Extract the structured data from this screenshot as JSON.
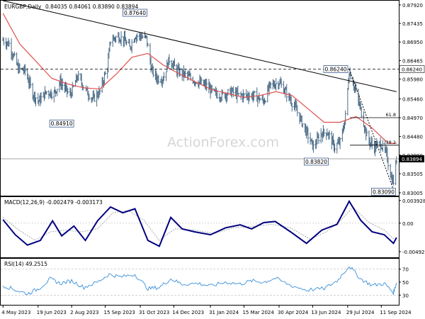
{
  "chart_data": [
    {
      "type": "bar",
      "subtype": "ohlc-price",
      "symbol_label": "EURGBP,Daily",
      "ohlc_label": "0.84035 0.84061 0.83890 0.83894",
      "last_price_label": "0.83894",
      "ylim": [
        0.8293,
        0.8803
      ],
      "y_ticks": [
        "0.87920",
        "0.87435",
        "0.86950",
        "0.86465",
        "0.85980",
        "0.85460",
        "0.84970",
        "0.84480",
        "0.83990",
        "0.83505",
        "0.83005"
      ],
      "y_tick_values": [
        0.8792,
        0.87435,
        0.8695,
        0.86465,
        0.8598,
        0.8546,
        0.8497,
        0.8448,
        0.8399,
        0.83505,
        0.83005
      ],
      "x_ticks": [
        "4 May 2023",
        "19 Jun 2023",
        "2 Aug 2023",
        "15 Sep 2023",
        "31 Oct 2023",
        "14 Dec 2023",
        "31 Jan 2024",
        "15 Mar 2024",
        "30 Apr 2024",
        "13 Jun 2024",
        "29 Jul 2024",
        "11 Sep 2024"
      ],
      "close_series": [
        [
          "2023-05-04",
          0.87
        ],
        [
          "2023-05-12",
          0.869
        ],
        [
          "2023-05-24",
          0.8625
        ],
        [
          "2023-06-02",
          0.862
        ],
        [
          "2023-06-12",
          0.856
        ],
        [
          "2023-06-20",
          0.854
        ],
        [
          "2023-06-30",
          0.8565
        ],
        [
          "2023-07-10",
          0.856
        ],
        [
          "2023-07-18",
          0.8591
        ],
        [
          "2023-07-31",
          0.8555
        ],
        [
          "2023-08-10",
          0.8605
        ],
        [
          "2023-08-22",
          0.8565
        ],
        [
          "2023-08-30",
          0.8545
        ],
        [
          "2023-09-08",
          0.8565
        ],
        [
          "2023-09-18",
          0.863
        ],
        [
          "2023-09-22",
          0.87
        ],
        [
          "2023-10-02",
          0.871
        ],
        [
          "2023-10-10",
          0.87
        ],
        [
          "2023-10-17",
          0.868
        ],
        [
          "2023-10-24",
          0.8712
        ],
        [
          "2023-10-31",
          0.871
        ],
        [
          "2023-11-08",
          0.8705
        ],
        [
          "2023-11-15",
          0.862
        ],
        [
          "2023-11-22",
          0.86
        ],
        [
          "2023-11-30",
          0.86
        ],
        [
          "2023-12-08",
          0.865
        ],
        [
          "2023-12-18",
          0.862
        ],
        [
          "2023-12-28",
          0.861
        ],
        [
          "2024-01-05",
          0.86
        ],
        [
          "2024-01-15",
          0.859
        ],
        [
          "2024-01-26",
          0.858
        ],
        [
          "2024-02-05",
          0.856
        ],
        [
          "2024-02-15",
          0.8555
        ],
        [
          "2024-02-28",
          0.8565
        ],
        [
          "2024-03-08",
          0.8555
        ],
        [
          "2024-03-20",
          0.8555
        ],
        [
          "2024-03-28",
          0.8555
        ],
        [
          "2024-04-10",
          0.854
        ],
        [
          "2024-04-18",
          0.858
        ],
        [
          "2024-04-30",
          0.859
        ],
        [
          "2024-05-10",
          0.856
        ],
        [
          "2024-05-22",
          0.852
        ],
        [
          "2024-05-30",
          0.8485
        ],
        [
          "2024-06-08",
          0.8445
        ],
        [
          "2024-06-14",
          0.842
        ],
        [
          "2024-06-24",
          0.8455
        ],
        [
          "2024-07-02",
          0.846
        ],
        [
          "2024-07-12",
          0.842
        ],
        [
          "2024-07-20",
          0.8435
        ],
        [
          "2024-07-26",
          0.85
        ],
        [
          "2024-07-31",
          0.862
        ],
        [
          "2024-08-08",
          0.857
        ],
        [
          "2024-08-16",
          0.851
        ],
        [
          "2024-08-24",
          0.844
        ],
        [
          "2024-09-02",
          0.842
        ],
        [
          "2024-09-10",
          0.843
        ],
        [
          "2024-09-18",
          0.84
        ],
        [
          "2024-09-24",
          0.834
        ],
        [
          "2024-09-27",
          0.833
        ],
        [
          "2024-10-01",
          0.8389
        ]
      ],
      "ma_series": [
        [
          "2023-05-04",
          0.877
        ],
        [
          "2023-05-26",
          0.869
        ],
        [
          "2023-06-16",
          0.8645
        ],
        [
          "2023-07-07",
          0.86
        ],
        [
          "2023-07-28",
          0.8585
        ],
        [
          "2023-08-18",
          0.8575
        ],
        [
          "2023-09-08",
          0.8572
        ],
        [
          "2023-09-29",
          0.861
        ],
        [
          "2023-10-20",
          0.8655
        ],
        [
          "2023-11-10",
          0.8665
        ],
        [
          "2023-11-30",
          0.8635
        ],
        [
          "2023-12-21",
          0.8612
        ],
        [
          "2024-01-12",
          0.859
        ],
        [
          "2024-02-02",
          0.857
        ],
        [
          "2024-02-23",
          0.856
        ],
        [
          "2024-03-15",
          0.855
        ],
        [
          "2024-04-05",
          0.8555
        ],
        [
          "2024-04-26",
          0.8565
        ],
        [
          "2024-05-17",
          0.8555
        ],
        [
          "2024-06-07",
          0.852
        ],
        [
          "2024-06-28",
          0.8485
        ],
        [
          "2024-07-19",
          0.8485
        ],
        [
          "2024-08-09",
          0.85
        ],
        [
          "2024-08-30",
          0.847
        ],
        [
          "2024-09-20",
          0.843
        ],
        [
          "2024-10-01",
          0.843
        ]
      ],
      "annotations": [
        {
          "label": "0.87640",
          "date": "2023-10-24",
          "value": 0.8764
        },
        {
          "label": "0.84910",
          "date": "2023-07-20",
          "value": 0.8491
        },
        {
          "label": "0.86240",
          "date": "2024-07-31",
          "value": 0.8624
        },
        {
          "label": "0.83820",
          "date": "2024-06-28",
          "value": 0.8382
        },
        {
          "label": "0.83090",
          "date": "2024-09-27",
          "value": 0.8309
        },
        {
          "label": "61.8",
          "date": "2024-09-10",
          "value": 0.8497
        },
        {
          "label": "38.2",
          "date": "2024-09-23",
          "value": 0.8425
        }
      ],
      "trendline": [
        [
          "2023-05-04",
          0.8803
        ],
        [
          "2024-10-01",
          0.8565
        ]
      ],
      "channel_line": [
        [
          "2024-07-31",
          0.8624
        ],
        [
          "2024-09-27",
          0.8309
        ]
      ],
      "horizontal_levels": [
        0.8624,
        0.83894
      ],
      "fib_levels": [
        0.8497,
        0.8425
      ],
      "watermark": "ActionForex.com",
      "colors": {
        "bars": "#4a6b87",
        "ma": "#e05050",
        "trend": "#000000",
        "last_price": "#000000"
      }
    },
    {
      "type": "line",
      "title": "MACD(12,26,9) -0.002479 -0.003173",
      "y_ticks": [
        "0.003928",
        "0.00",
        "-0.004929"
      ],
      "y_tick_values": [
        0.003928,
        0.0,
        -0.004929
      ],
      "ylim": [
        -0.0058,
        0.0044
      ],
      "series": [
        {
          "name": "MACD",
          "color": "#000080",
          "points": [
            [
              "2023-05-04",
              0.0006
            ],
            [
              "2023-05-20",
              -0.002
            ],
            [
              "2023-06-05",
              -0.0038
            ],
            [
              "2023-06-22",
              -0.003
            ],
            [
              "2023-07-08",
              0.0004
            ],
            [
              "2023-07-20",
              -0.0022
            ],
            [
              "2023-08-05",
              -0.0005
            ],
            [
              "2023-08-20",
              -0.003
            ],
            [
              "2023-09-05",
              0.0004
            ],
            [
              "2023-09-22",
              0.0028
            ],
            [
              "2023-10-08",
              0.0018
            ],
            [
              "2023-10-24",
              0.0025
            ],
            [
              "2023-11-10",
              -0.003
            ],
            [
              "2023-11-25",
              -0.004
            ],
            [
              "2023-12-10",
              0.001
            ],
            [
              "2023-12-25",
              -0.001
            ],
            [
              "2024-01-10",
              -0.0015
            ],
            [
              "2024-01-31",
              -0.002
            ],
            [
              "2024-02-20",
              -0.0008
            ],
            [
              "2024-03-10",
              -0.0003
            ],
            [
              "2024-03-25",
              -0.001
            ],
            [
              "2024-04-10",
              0.0001
            ],
            [
              "2024-04-25",
              0.0003
            ],
            [
              "2024-05-15",
              -0.0015
            ],
            [
              "2024-06-05",
              -0.0035
            ],
            [
              "2024-06-25",
              -0.0012
            ],
            [
              "2024-07-15",
              -0.0002
            ],
            [
              "2024-07-31",
              0.0038
            ],
            [
              "2024-08-15",
              0.0005
            ],
            [
              "2024-08-30",
              -0.0015
            ],
            [
              "2024-09-15",
              -0.002
            ],
            [
              "2024-09-27",
              -0.0035
            ],
            [
              "2024-10-01",
              -0.0025
            ]
          ]
        },
        {
          "name": "Signal",
          "color": "#aaaaaa",
          "points": [
            [
              "2023-05-04",
              0.001
            ],
            [
              "2023-05-25",
              -0.0012
            ],
            [
              "2023-06-15",
              -0.003
            ],
            [
              "2023-07-05",
              -0.0015
            ],
            [
              "2023-07-25",
              -0.0012
            ],
            [
              "2023-08-15",
              -0.0015
            ],
            [
              "2023-09-05",
              -0.001
            ],
            [
              "2023-09-25",
              0.0018
            ],
            [
              "2023-10-15",
              0.0022
            ],
            [
              "2023-11-05",
              0.0005
            ],
            [
              "2023-11-25",
              -0.003
            ],
            [
              "2023-12-15",
              -0.001
            ],
            [
              "2024-01-10",
              -0.0012
            ],
            [
              "2024-02-05",
              -0.0018
            ],
            [
              "2024-03-01",
              -0.0008
            ],
            [
              "2024-03-25",
              -0.0006
            ],
            [
              "2024-04-20",
              -0.0002
            ],
            [
              "2024-05-15",
              -0.0008
            ],
            [
              "2024-06-10",
              -0.0028
            ],
            [
              "2024-07-01",
              -0.0015
            ],
            [
              "2024-07-20",
              0.0005
            ],
            [
              "2024-08-05",
              0.0028
            ],
            [
              "2024-08-25",
              0.0002
            ],
            [
              "2024-09-15",
              -0.0012
            ],
            [
              "2024-10-01",
              -0.0032
            ]
          ]
        }
      ]
    },
    {
      "type": "line",
      "title": "RSI(14) 49.2515",
      "y_ticks": [
        "70",
        "50",
        "30"
      ],
      "y_tick_values": [
        70,
        50,
        30
      ],
      "ylim": [
        15,
        85
      ],
      "series": [
        {
          "name": "RSI",
          "color": "#3a8fd9",
          "points": [
            [
              "2023-05-04",
              45
            ],
            [
              "2023-05-20",
              38
            ],
            [
              "2023-06-05",
              32
            ],
            [
              "2023-06-20",
              40
            ],
            [
              "2023-07-05",
              55
            ],
            [
              "2023-07-18",
              48
            ],
            [
              "2023-08-02",
              52
            ],
            [
              "2023-08-18",
              42
            ],
            [
              "2023-09-05",
              50
            ],
            [
              "2023-09-20",
              62
            ],
            [
              "2023-10-05",
              58
            ],
            [
              "2023-10-24",
              62
            ],
            [
              "2023-11-10",
              40
            ],
            [
              "2023-11-25",
              42
            ],
            [
              "2023-12-10",
              55
            ],
            [
              "2023-12-25",
              47
            ],
            [
              "2024-01-15",
              48
            ],
            [
              "2024-01-31",
              44
            ],
            [
              "2024-02-20",
              50
            ],
            [
              "2024-03-10",
              47
            ],
            [
              "2024-03-25",
              52
            ],
            [
              "2024-04-10",
              50
            ],
            [
              "2024-04-25",
              56
            ],
            [
              "2024-05-15",
              45
            ],
            [
              "2024-06-05",
              38
            ],
            [
              "2024-06-28",
              40
            ],
            [
              "2024-07-15",
              52
            ],
            [
              "2024-07-31",
              75
            ],
            [
              "2024-08-15",
              55
            ],
            [
              "2024-08-30",
              45
            ],
            [
              "2024-09-15",
              48
            ],
            [
              "2024-09-27",
              34
            ],
            [
              "2024-10-01",
              49
            ]
          ]
        }
      ]
    }
  ]
}
